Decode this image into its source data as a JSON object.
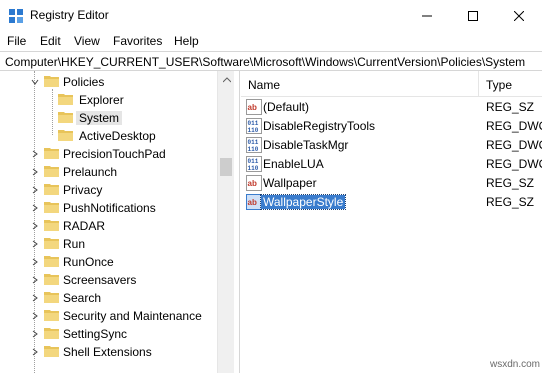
{
  "window": {
    "title": "Registry Editor",
    "app_icon": "registry-editor-icon",
    "controls": [
      "minimize-icon",
      "maximize-icon",
      "close-icon"
    ]
  },
  "menu": [
    "File",
    "Edit",
    "View",
    "Favorites",
    "Help"
  ],
  "address": "Computer\\HKEY_CURRENT_USER\\Software\\Microsoft\\Windows\\CurrentVersion\\Policies\\System",
  "tree": [
    {
      "label": "Policies",
      "expanded": true
    },
    {
      "label": "Explorer"
    },
    {
      "label": "System",
      "selected": true
    },
    {
      "label": "ActiveDesktop"
    },
    {
      "label": "PrecisionTouchPad",
      "expandable": true
    },
    {
      "label": "Prelaunch",
      "expandable": true
    },
    {
      "label": "Privacy",
      "expandable": true
    },
    {
      "label": "PushNotifications",
      "expandable": true
    },
    {
      "label": "RADAR",
      "expandable": true
    },
    {
      "label": "Run",
      "expandable": true
    },
    {
      "label": "RunOnce",
      "expandable": true
    },
    {
      "label": "Screensavers",
      "expandable": true
    },
    {
      "label": "Search",
      "expandable": true
    },
    {
      "label": "Security and Maintenance",
      "expandable": true
    },
    {
      "label": "SettingSync",
      "expandable": true
    },
    {
      "label": "Shell Extensions",
      "expandable": true
    }
  ],
  "columns": {
    "name": "Name",
    "type": "Type"
  },
  "values": [
    {
      "name": "(Default)",
      "type": "REG_SZ",
      "icon": "string-value-icon"
    },
    {
      "name": "DisableRegistryTools",
      "type": "REG_DWO",
      "icon": "binary-value-icon"
    },
    {
      "name": "DisableTaskMgr",
      "type": "REG_DWO",
      "icon": "binary-value-icon"
    },
    {
      "name": "EnableLUA",
      "type": "REG_DWO",
      "icon": "binary-value-icon"
    },
    {
      "name": "Wallpaper",
      "type": "REG_SZ",
      "icon": "string-value-icon"
    },
    {
      "name": "WallpaperStyle",
      "type": "REG_SZ",
      "icon": "string-value-icon",
      "selected": true
    }
  ],
  "watermark": "wsxdn.com",
  "colors": {
    "folder": "#e8c45a",
    "selection": "#3a7ccd",
    "string_icon": "#c0392b",
    "binary_icon": "#2b5aa8"
  }
}
